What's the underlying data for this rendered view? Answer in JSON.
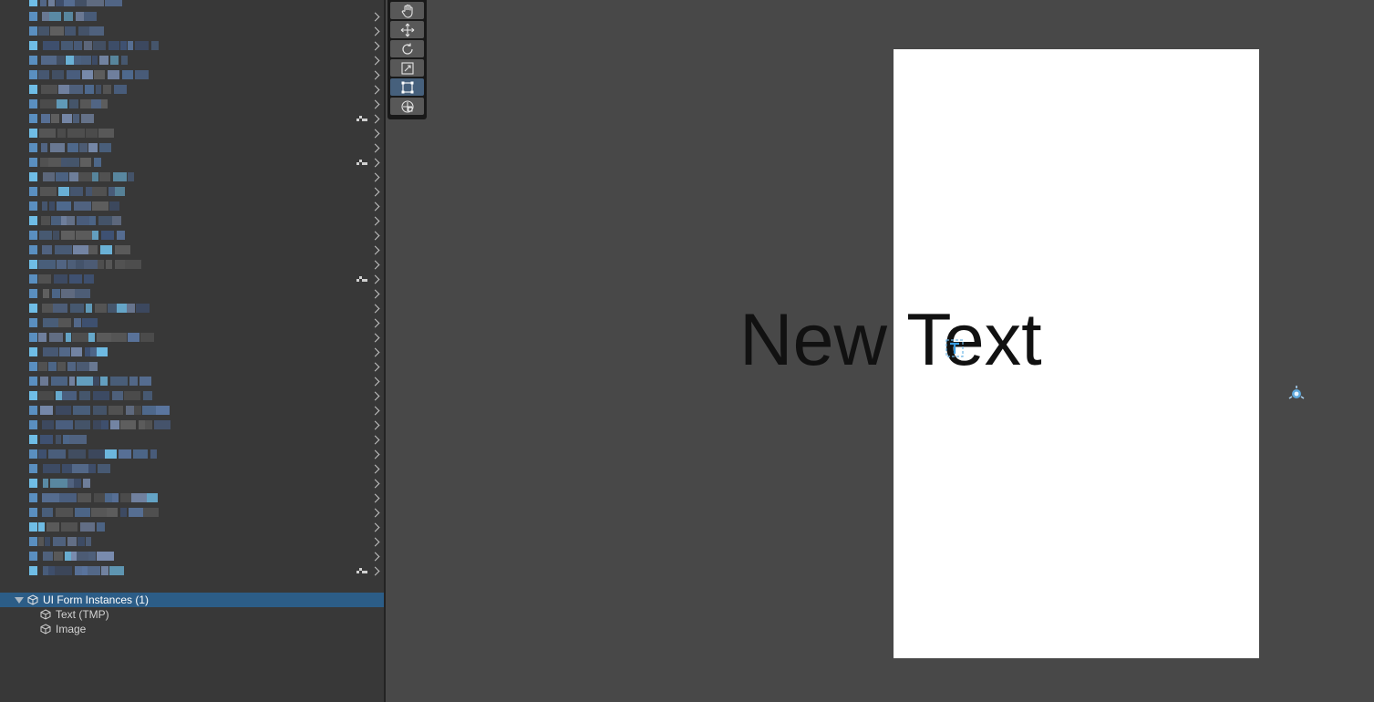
{
  "hierarchy": {
    "items": [
      {
        "label": "UI Form Instances (1)",
        "selected": true,
        "expanded": true
      },
      {
        "label": "Text (TMP)",
        "selected": false
      },
      {
        "label": "Image",
        "selected": false
      }
    ]
  },
  "toolbar": {
    "tools": [
      {
        "name": "hand-tool",
        "icon": "hand-icon",
        "active": false
      },
      {
        "name": "move-tool",
        "icon": "move-icon",
        "active": false
      },
      {
        "name": "rotate-tool",
        "icon": "rotate-icon",
        "active": false
      },
      {
        "name": "scale-tool",
        "icon": "scale-icon",
        "active": false
      },
      {
        "name": "rect-tool",
        "icon": "rect-transform-icon",
        "active": true
      },
      {
        "name": "transform-tool",
        "icon": "transform-icon",
        "active": false
      }
    ]
  },
  "scene": {
    "text_object": "New Text",
    "canvas_color": "#ffffff",
    "background_color": "#484848"
  },
  "colors": {
    "selection": "#2c5d87",
    "active_tool": "#46607c"
  }
}
